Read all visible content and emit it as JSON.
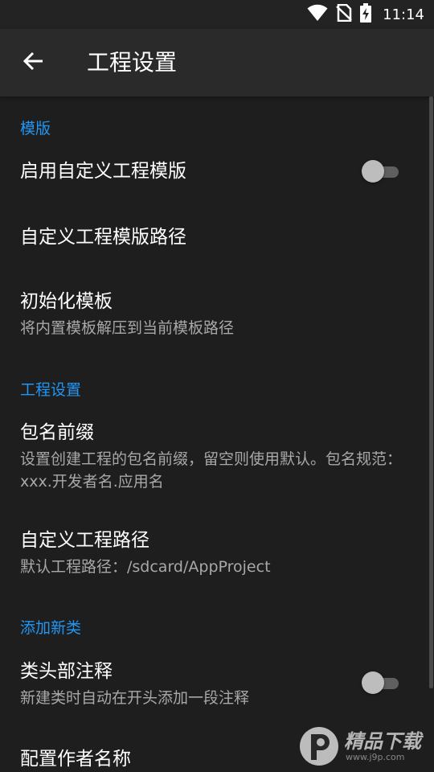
{
  "status_bar": {
    "time": "11:14",
    "icons": [
      "wifi-icon",
      "no-sim-icon",
      "battery-charging-icon"
    ]
  },
  "toolbar": {
    "back_icon": "arrow-left-icon",
    "title": "工程设置"
  },
  "sections": {
    "template": {
      "header": "模版",
      "enable_custom": {
        "title": "启用自定义工程模版",
        "switch_on": false
      },
      "custom_path": {
        "title": "自定义工程模版路径"
      },
      "init_template": {
        "title": "初始化模板",
        "summary": "将内置模板解压到当前模板路径"
      }
    },
    "project": {
      "header": "工程设置",
      "package_prefix": {
        "title": "包名前缀",
        "summary": "设置创建工程的包名前缀，留空则使用默认。包名规范：xxx.开发者名.应用名"
      },
      "custom_project_path": {
        "title": "自定义工程路径",
        "summary": "默认工程路径：/sdcard/AppProject"
      }
    },
    "new_class": {
      "header": "添加新类",
      "class_header_comment": {
        "title": "类头部注释",
        "summary": "新建类时自动在开头添加一段注释",
        "switch_on": false
      },
      "author_name": {
        "title": "配置作者名称"
      }
    }
  },
  "watermark": {
    "main": "精品下载",
    "sub": "www.j9p.com"
  },
  "colors": {
    "accent": "#2196f3",
    "background": "#1e1e1e",
    "toolbar": "#2a2a2a",
    "summary_text": "#a8a8a8"
  }
}
